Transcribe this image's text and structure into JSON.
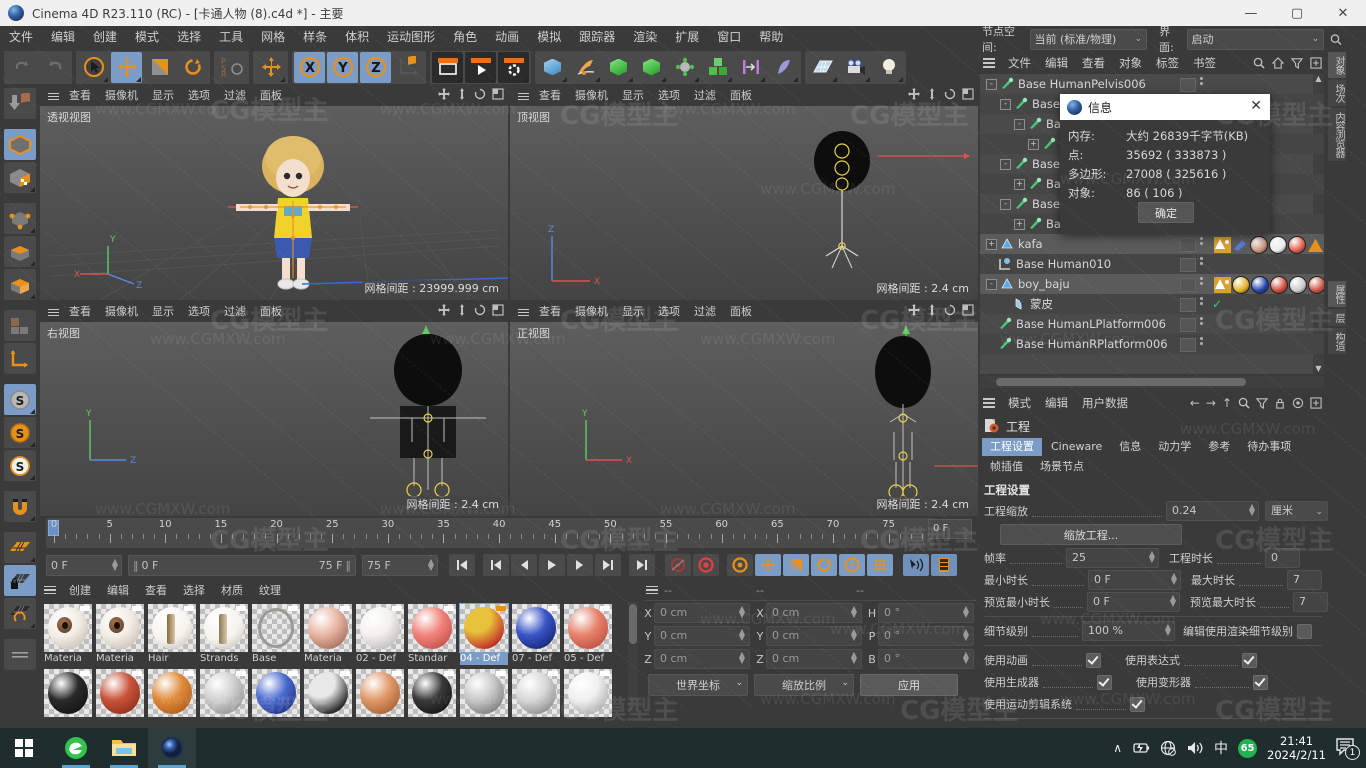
{
  "window": {
    "title": "Cinema 4D R23.110 (RC) - [卡通人物 (8).c4d *] - 主要",
    "minimize": "—",
    "maximize": "▢",
    "close": "✕"
  },
  "menubar": {
    "items": [
      "文件",
      "编辑",
      "创建",
      "模式",
      "选择",
      "工具",
      "网格",
      "样条",
      "体积",
      "运动图形",
      "角色",
      "动画",
      "模拟",
      "跟踪器",
      "渲染",
      "扩展",
      "窗口",
      "帮助"
    ]
  },
  "nodespace": {
    "label": "节点空间:",
    "value": "当前 (标准/物理)",
    "interface_label": "界面:",
    "interface_value": "启动",
    "search_icon": "search-icon"
  },
  "object_manager": {
    "menu": [
      "文件",
      "编辑",
      "查看",
      "对象",
      "标签",
      "书签"
    ],
    "items": [
      {
        "name": "Base HumanPelvis006",
        "depth": 0,
        "icon": "joint-icon",
        "expander": "-"
      },
      {
        "name": "Base H",
        "depth": 1,
        "icon": "joint-icon",
        "expander": "-"
      },
      {
        "name": "Base",
        "depth": 2,
        "icon": "joint-icon",
        "expander": "-"
      },
      {
        "name": "Ba",
        "depth": 3,
        "icon": "joint-icon",
        "expander": "+"
      },
      {
        "name": "Base H",
        "depth": 1,
        "icon": "joint-icon",
        "expander": "-"
      },
      {
        "name": "Base",
        "depth": 2,
        "icon": "joint-icon",
        "expander": "+"
      },
      {
        "name": "Base H",
        "depth": 1,
        "icon": "joint-icon",
        "expander": "-"
      },
      {
        "name": "Base",
        "depth": 2,
        "icon": "joint-icon",
        "expander": "+"
      },
      {
        "name": "kafa",
        "depth": 0,
        "icon": "polygon-object-icon",
        "expander": "+"
      },
      {
        "name": "Base Human010",
        "depth": 0,
        "icon": "null-object-icon",
        "expander": ""
      },
      {
        "name": "boy_baju",
        "depth": 0,
        "icon": "polygon-object-icon",
        "expander": "-"
      },
      {
        "name": "蒙皮",
        "depth": 1,
        "icon": "skin-deformer-icon",
        "expander": ""
      },
      {
        "name": "Base HumanLPlatform006",
        "depth": 0,
        "icon": "joint-icon",
        "expander": ""
      },
      {
        "name": "Base HumanRPlatform006",
        "depth": 0,
        "icon": "joint-icon",
        "expander": ""
      }
    ],
    "tag_colors_kafa": [
      "#c8937a",
      "#e8e8e8",
      "#e05a4a"
    ],
    "tag_colors_boy": [
      "#e0b020",
      "#2040b0",
      "#d04a3a",
      "#c8c8c8",
      "#c85040"
    ]
  },
  "info_dialog": {
    "title": "信息",
    "close": "✕",
    "rows": [
      {
        "key": "内存:",
        "value": "大约 26839千字节(KB)"
      },
      {
        "key": "点:",
        "value": "35692 ( 333873 )"
      },
      {
        "key": "多边形:",
        "value": "27008 ( 325616 )"
      },
      {
        "key": "对象:",
        "value": "86 ( 106 )"
      }
    ],
    "ok": "确定"
  },
  "attributes": {
    "menu": [
      "模式",
      "编辑",
      "用户数据"
    ],
    "object_title": "工程",
    "tabs": [
      "工程设置",
      "Cineware",
      "信息",
      "动力学",
      "参考",
      "待办事项",
      "帧插值",
      "场景节点"
    ],
    "active_tab": "工程设置",
    "section_title": "工程设置",
    "scale_label": "工程缩放",
    "scale_value": "0.24",
    "scale_unit": "厘米",
    "scale_button": "缩放工程...",
    "fields": [
      {
        "label": "帧率",
        "value": "25",
        "label2": "工程时长",
        "value2": "0"
      },
      {
        "label": "最小时长",
        "value": "0 F",
        "label2": "最大时长",
        "value2": "7"
      },
      {
        "label": "预览最小时长",
        "value": "0 F",
        "label2": "预览最大时长",
        "value2": "7"
      }
    ],
    "lod_label": "细节级别",
    "lod_value": "100 %",
    "lod_label2": "编辑使用渲染细节级别",
    "checks": [
      {
        "label": "使用动画",
        "on": true,
        "label2": "使用表达式",
        "on2": true
      },
      {
        "label": "使用生成器",
        "on": true,
        "label2": "使用变形器",
        "on2": true
      },
      {
        "label": "使用运动剪辑系统",
        "on": true,
        "label2": "",
        "on2": null
      }
    ]
  },
  "vertical_tabs": [
    {
      "label": "对象",
      "active": true
    },
    {
      "label": "场次",
      "active": false
    },
    {
      "label": "内容浏览器",
      "active": false
    },
    {
      "label": "属性",
      "active": true
    },
    {
      "label": "层",
      "active": false
    },
    {
      "label": "构造",
      "active": false
    }
  ],
  "viewports": [
    {
      "label": "透视视图",
      "menu": [
        "查看",
        "摄像机",
        "显示",
        "选项",
        "过滤",
        "面板"
      ],
      "grid": "网格间距 : 23999.999 cm"
    },
    {
      "label": "顶视图",
      "menu": [
        "查看",
        "摄像机",
        "显示",
        "选项",
        "过滤",
        "面板"
      ],
      "grid": "网格间距 : 2.4 cm"
    },
    {
      "label": "右视图",
      "menu": [
        "查看",
        "摄像机",
        "显示",
        "选项",
        "过滤",
        "面板"
      ],
      "grid": "网格间距 : 2.4 cm"
    },
    {
      "label": "正视图",
      "menu": [
        "查看",
        "摄像机",
        "显示",
        "选项",
        "过滤",
        "面板"
      ],
      "grid": "网格间距 : 2.4 cm"
    }
  ],
  "timeline": {
    "ticks": [
      0,
      5,
      10,
      15,
      20,
      25,
      30,
      35,
      40,
      45,
      50,
      55,
      60,
      65,
      70,
      75
    ],
    "current_frame": "0 F",
    "fields": {
      "start": "0 F",
      "range_start": "0 F",
      "range_end": "75 F",
      "end": "75 F"
    }
  },
  "materials": {
    "menu": [
      "创建",
      "编辑",
      "查看",
      "选择",
      "材质",
      "纹理"
    ],
    "items": [
      {
        "name": "Materia",
        "color1": "#f2ece4",
        "color2": "#6a4a34",
        "kind": "eye",
        "selected": false
      },
      {
        "name": "Materia",
        "color1": "#f2ece4",
        "color2": "#6a4a34",
        "kind": "eye",
        "selected": false
      },
      {
        "name": "Hair",
        "color1": "#f6f3ee",
        "color2": "#8a6a3a",
        "kind": "hair",
        "selected": false
      },
      {
        "name": "Strands",
        "color1": "#f6f3ee",
        "color2": "#8a7a5a",
        "kind": "hair",
        "selected": false
      },
      {
        "name": "Base",
        "color1": "#d9d4cc",
        "color2": "#9a9a96",
        "kind": "ring",
        "selected": false
      },
      {
        "name": "Materia",
        "color1": "#e8b6a4",
        "color2": "#9c6450",
        "kind": "solid",
        "selected": false
      },
      {
        "name": "02 - Def",
        "color1": "#f3f1ee",
        "color2": "#b9b6b2",
        "kind": "solid",
        "selected": false
      },
      {
        "name": "Standar",
        "color1": "#f0857c",
        "color2": "#c24a42",
        "kind": "solid",
        "selected": false
      },
      {
        "name": "04 - Def",
        "color1": "#e8c23a",
        "color2": "#c43a2a",
        "kind": "mix",
        "selected": true
      },
      {
        "name": "07 - Def",
        "color1": "#3a56c8",
        "color2": "#10206a",
        "kind": "solid",
        "selected": false
      },
      {
        "name": "05 - Def",
        "color1": "#e8836e",
        "color2": "#b84a38",
        "kind": "solid",
        "selected": false
      },
      {
        "name": "",
        "color1": "#2a2a2a",
        "color2": "#101010",
        "kind": "solid",
        "selected": false
      },
      {
        "name": "",
        "color1": "#c8543a",
        "color2": "#8a2a18",
        "kind": "solid",
        "selected": false
      },
      {
        "name": "",
        "color1": "#e08a3a",
        "color2": "#a85a18",
        "kind": "solid",
        "selected": false
      },
      {
        "name": "",
        "color1": "#d0d0d0",
        "color2": "#8a8a8a",
        "kind": "solid",
        "selected": false
      },
      {
        "name": "",
        "color1": "#4a6ad0",
        "color2": "#1a2a7a",
        "kind": "solid",
        "selected": false
      },
      {
        "name": "",
        "color1": "#e8e8e8",
        "color2": "#303030",
        "kind": "mix",
        "selected": false
      },
      {
        "name": "",
        "color1": "#e09a6a",
        "color2": "#a05a2a",
        "kind": "solid",
        "selected": false
      },
      {
        "name": "",
        "color1": "#3a3a3a",
        "color2": "#101010",
        "kind": "solid",
        "selected": false
      },
      {
        "name": "",
        "color1": "#c8c8c8",
        "color2": "#707070",
        "kind": "solid",
        "selected": false
      },
      {
        "name": "",
        "color1": "#d8d8d8",
        "color2": "#808080",
        "kind": "solid",
        "selected": false
      },
      {
        "name": "",
        "color1": "#f0f0f0",
        "color2": "#a0a0a0",
        "kind": "solid",
        "selected": false
      }
    ]
  },
  "coordinates": {
    "dash": "--",
    "rows": [
      {
        "l1": "X",
        "v1": "0 cm",
        "l2": "X",
        "v2": "0 cm",
        "l3": "H",
        "v3": "0 °"
      },
      {
        "l1": "Y",
        "v1": "0 cm",
        "l2": "Y",
        "v2": "0 cm",
        "l3": "P",
        "v3": "0 °"
      },
      {
        "l1": "Z",
        "v1": "0 cm",
        "l2": "Z",
        "v2": "0 cm",
        "l3": "B",
        "v3": "0 °"
      }
    ],
    "system": "世界坐标",
    "mode": "缩放比例",
    "apply": "应用"
  },
  "taskbar": {
    "items": [
      "windows-start-icon",
      "edge-browser-icon",
      "file-explorer-icon",
      "cinema4d-icon"
    ],
    "tray": {
      "chevron": "∧",
      "battery": "battery-icon",
      "network": "network-icon",
      "volume": "volume-icon",
      "ime": "中",
      "badge": "65"
    },
    "time": "21:41",
    "date": "2024/2/11",
    "notification": "1"
  },
  "watermarks": {
    "small": "www.CGMXW.com",
    "big": "CG模型主"
  }
}
